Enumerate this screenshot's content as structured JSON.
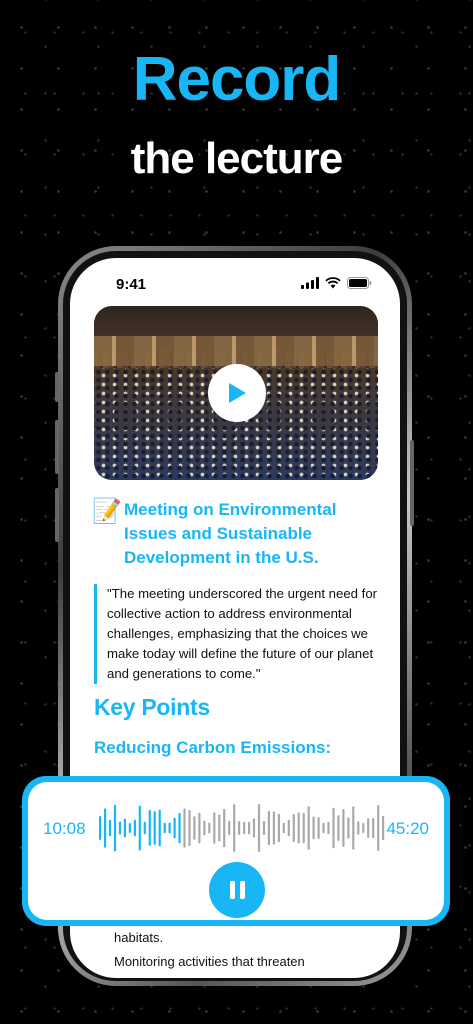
{
  "headline": {
    "line1": "Record",
    "line2": "the lecture"
  },
  "status_bar": {
    "time": "9:41"
  },
  "video": {
    "thumbnail": "congress-hall-image",
    "play_icon": "play-icon"
  },
  "lecture": {
    "emoji": "📝",
    "title": "Meeting on Environmental Issues and Sustainable Development in the U.S.",
    "quote": "\"The meeting underscored the urgent need for collective action to address environmental challenges, emphasizing that the choices we make today will define the future of our planet and generations to come.\"",
    "key_points_heading": "Key Points",
    "subheading": "Reducing Carbon Emissions:",
    "partial_line1": "habitats.",
    "partial_line2": "Monitoring activities that threaten"
  },
  "player": {
    "current_time": "10:08",
    "total_time": "45:20",
    "progress": 0.3,
    "pause_icon": "pause-icon"
  },
  "colors": {
    "accent": "#19b6f5",
    "played_wave": "#19b6f5",
    "unplayed_wave": "#a9a9a9"
  }
}
